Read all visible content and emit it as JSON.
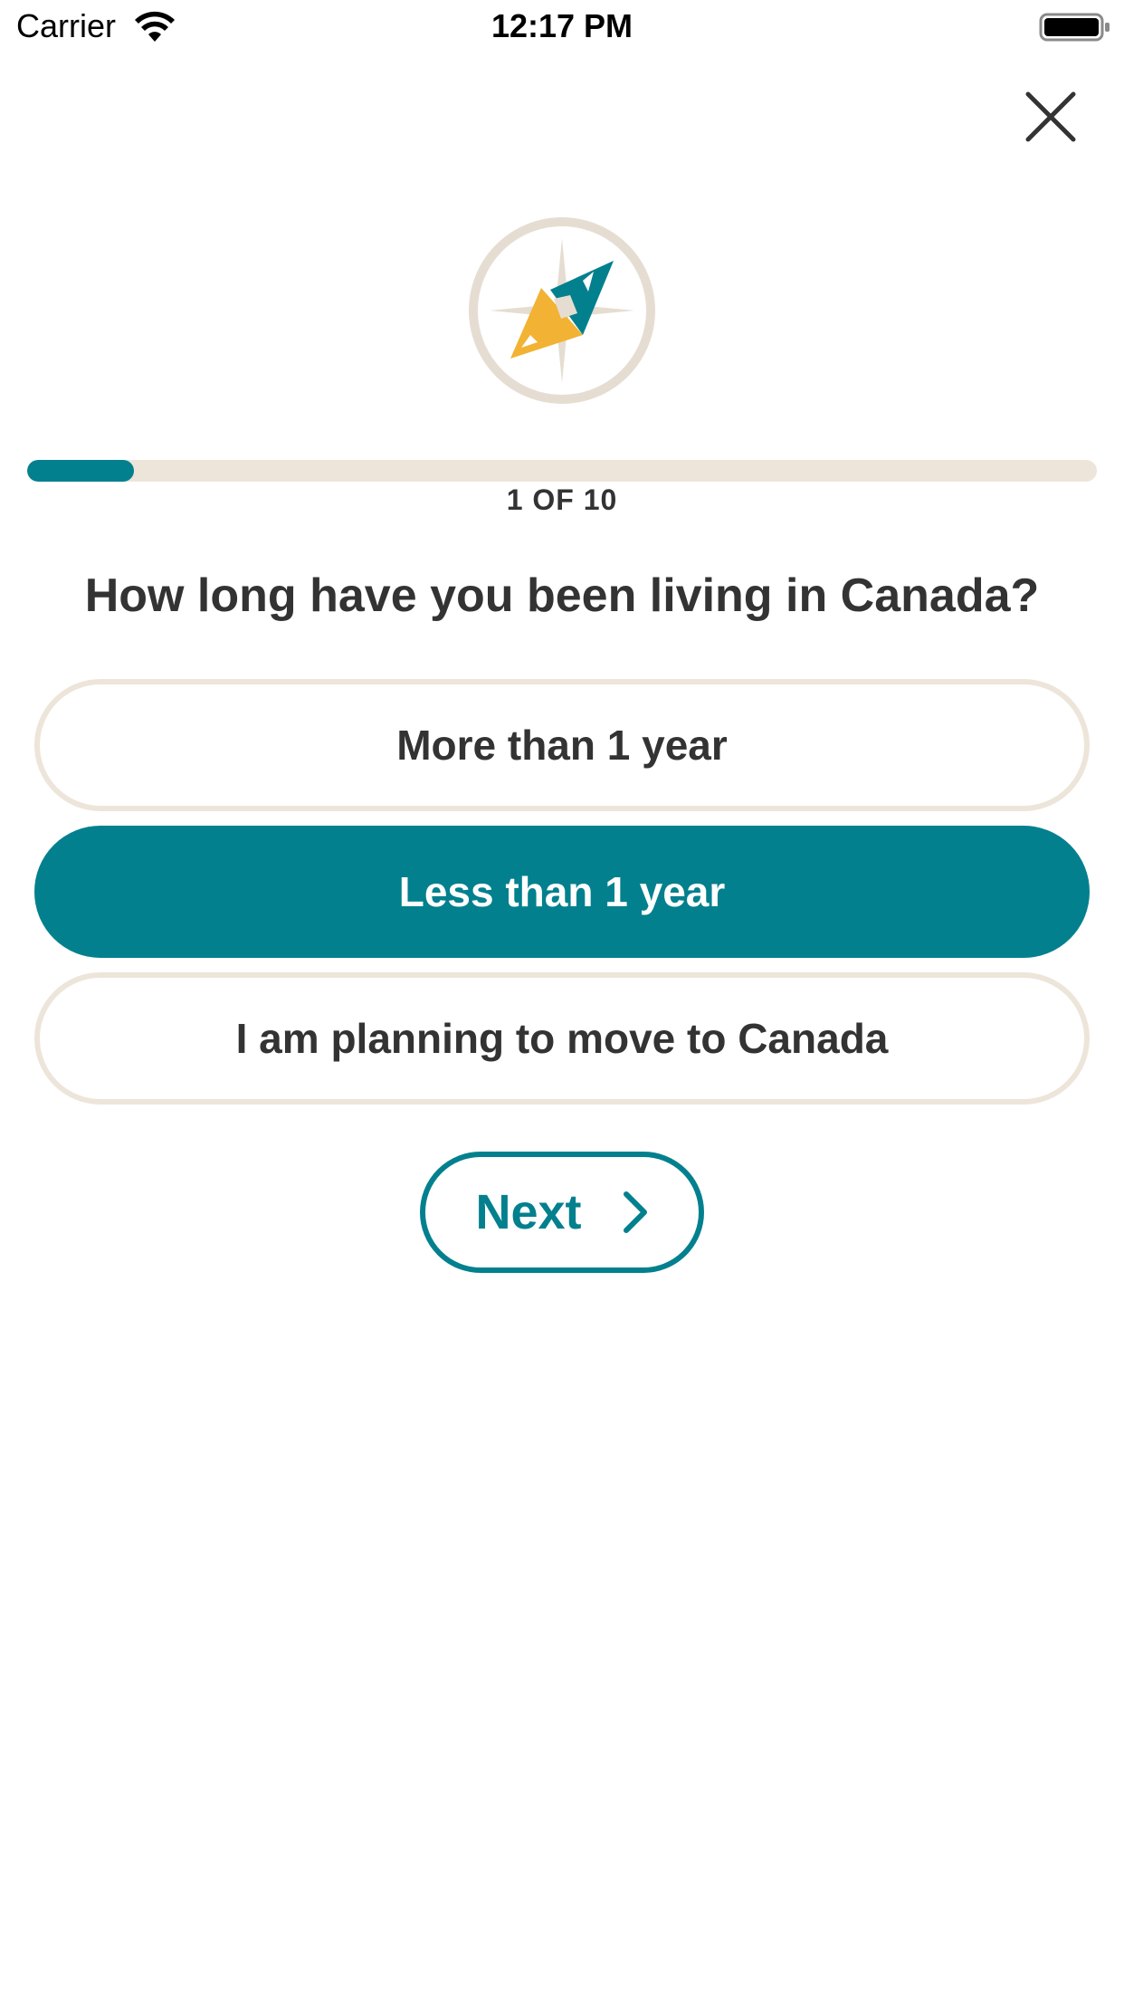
{
  "status_bar": {
    "carrier": "Carrier",
    "time": "12:17 PM",
    "icons": [
      "wifi-icon",
      "battery-icon"
    ]
  },
  "header": {
    "close_icon": "close-icon",
    "logo_icon": "compass-logo-icon"
  },
  "progress": {
    "label": "1 OF 10",
    "current": 1,
    "total": 10,
    "fill_fraction": 0.1
  },
  "question": {
    "text": "How long have you been living in Canada?"
  },
  "options": [
    {
      "label": "More than 1 year",
      "selected": false
    },
    {
      "label": "Less than 1 year",
      "selected": true
    },
    {
      "label": "I am planning to move to Canada",
      "selected": false
    }
  ],
  "actions": {
    "next_label": "Next",
    "next_icon": "chevron-right-icon"
  },
  "colors": {
    "accent": "#03808e",
    "track": "#ede5da",
    "text": "#333333",
    "logo_yellow": "#f2b233"
  }
}
